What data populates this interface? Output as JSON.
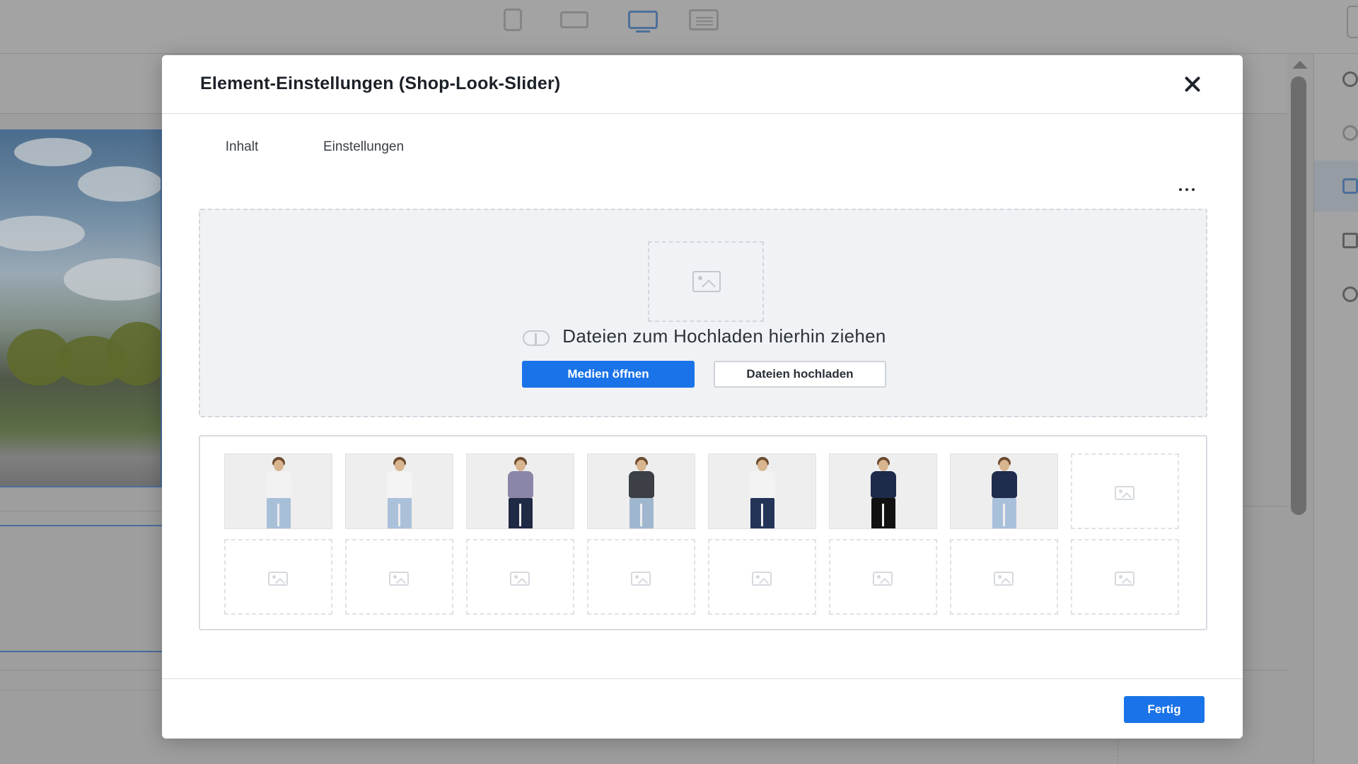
{
  "modal": {
    "title": "Element-Einstellungen (Shop-Look-Slider)"
  },
  "tabs": [
    {
      "label": "Inhalt",
      "active": true
    },
    {
      "label": "Einstellungen",
      "active": false
    }
  ],
  "dropzone": {
    "text": "Dateien zum Hochladen hierhin ziehen",
    "open_media_label": "Medien öffnen",
    "upload_files_label": "Dateien hochladen"
  },
  "gallery": {
    "slots_total": 16,
    "filled_slots": 7,
    "images": [
      {
        "top": "#f2f2f2",
        "bottom": "#a8bfd8"
      },
      {
        "top": "#f4f4f4",
        "bottom": "#aac1d9"
      },
      {
        "top": "#8a86a8",
        "bottom": "#1f2a44"
      },
      {
        "top": "#3c3f46",
        "bottom": "#9fb6cf"
      },
      {
        "top": "#f3f3f3",
        "bottom": "#243457"
      },
      {
        "top": "#1e2a4a",
        "bottom": "#111111"
      },
      {
        "top": "#202c4e",
        "bottom": "#a9c0da"
      }
    ]
  },
  "footer": {
    "done_label": "Fertig"
  },
  "colors": {
    "accent": "#1a73e8",
    "overlay": "#9c9c9c"
  }
}
